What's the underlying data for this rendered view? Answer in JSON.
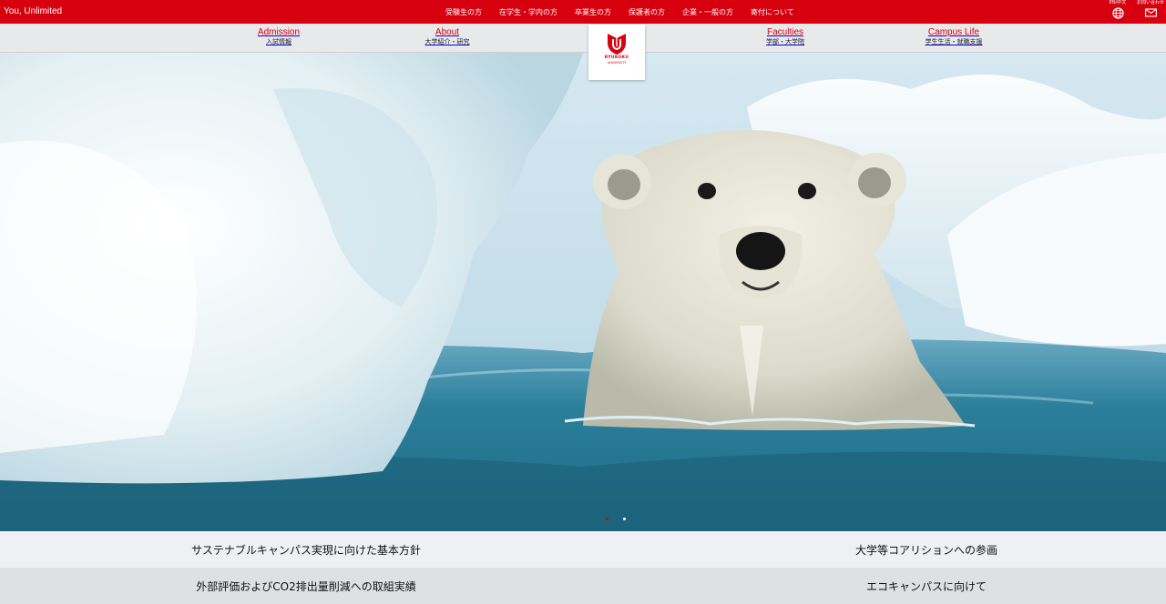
{
  "topbar": {
    "slogan": "You, Unlimited",
    "links": [
      "受験生の方",
      "在学生・学内の方",
      "卒業生の方",
      "保護者の方",
      "企業・一般の方",
      "寄付について"
    ],
    "lang_label": "EN/中文",
    "contact_label": "お問い合わせ",
    "lang_icon": "globe-icon",
    "contact_icon": "mail-icon"
  },
  "nav": {
    "items": [
      {
        "en": "Admission",
        "ja": "入試情報"
      },
      {
        "en": "About",
        "ja": "大学紹介・研究"
      },
      {
        "en": "Faculties",
        "ja": "学部・大学院"
      },
      {
        "en": "Campus Life",
        "ja": "学生生活・就職支援"
      }
    ]
  },
  "logo": {
    "name": "RYUKOKU",
    "sub": "UNIVERSITY"
  },
  "hero": {
    "slides_total": 2,
    "slide_active": 1
  },
  "links": {
    "row1": [
      "サステナブルキャンパス実現に向けた基本方針",
      "大学等コアリションへの参画"
    ],
    "row2": [
      "外部評価およびCO2排出量削減への取組実績",
      "エコキャンパスに向けて"
    ]
  },
  "colors": {
    "brand": "#d7000f",
    "nav_bg": "#e8e9eb"
  }
}
